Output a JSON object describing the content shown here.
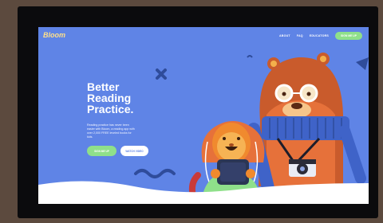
{
  "site": {
    "logo": "Bloom"
  },
  "nav": {
    "items": [
      "ABOUT",
      "FAQ",
      "EDUCATORS"
    ],
    "cta": "SIGN ME UP"
  },
  "hero": {
    "headline": [
      "Better",
      "Reading",
      "Practice."
    ],
    "description": "Reading practice has never been easier with Bloom, a reading app with over 2,000 FREE leveled books for kids.",
    "primary_button": "SIGN ME UP",
    "secondary_button": "WATCH VIDEO"
  },
  "colors": {
    "background": "#5f84e6",
    "accent_green": "#8fe08a",
    "bear_brown": "#c95b2c",
    "lion_orange": "#f08a2e"
  }
}
